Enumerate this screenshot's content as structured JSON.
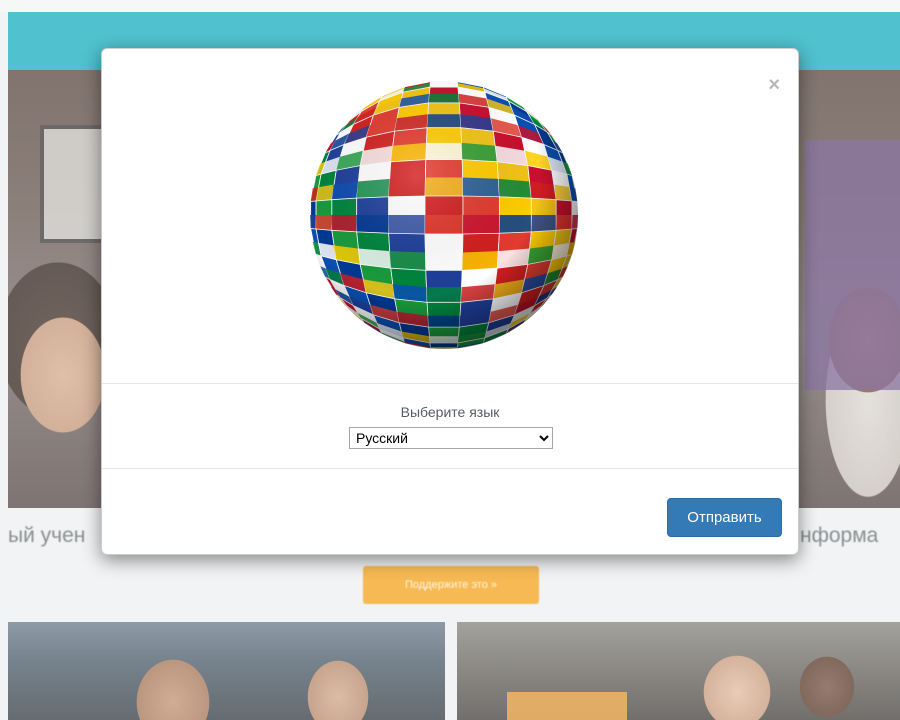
{
  "background": {
    "text_left": "ый учен",
    "text_right": "нформа",
    "orange_button_label": "Поддержите это »"
  },
  "modal": {
    "close_label": "×",
    "prompt": "Выберите язык",
    "language_selected": "Русский",
    "submit_label": "Отправить",
    "globe_icon": "flags-globe-icon"
  },
  "colors": {
    "navbar": "#1fb0c0",
    "primary_button": "#337ab7",
    "orange_button": "#f5a623"
  }
}
